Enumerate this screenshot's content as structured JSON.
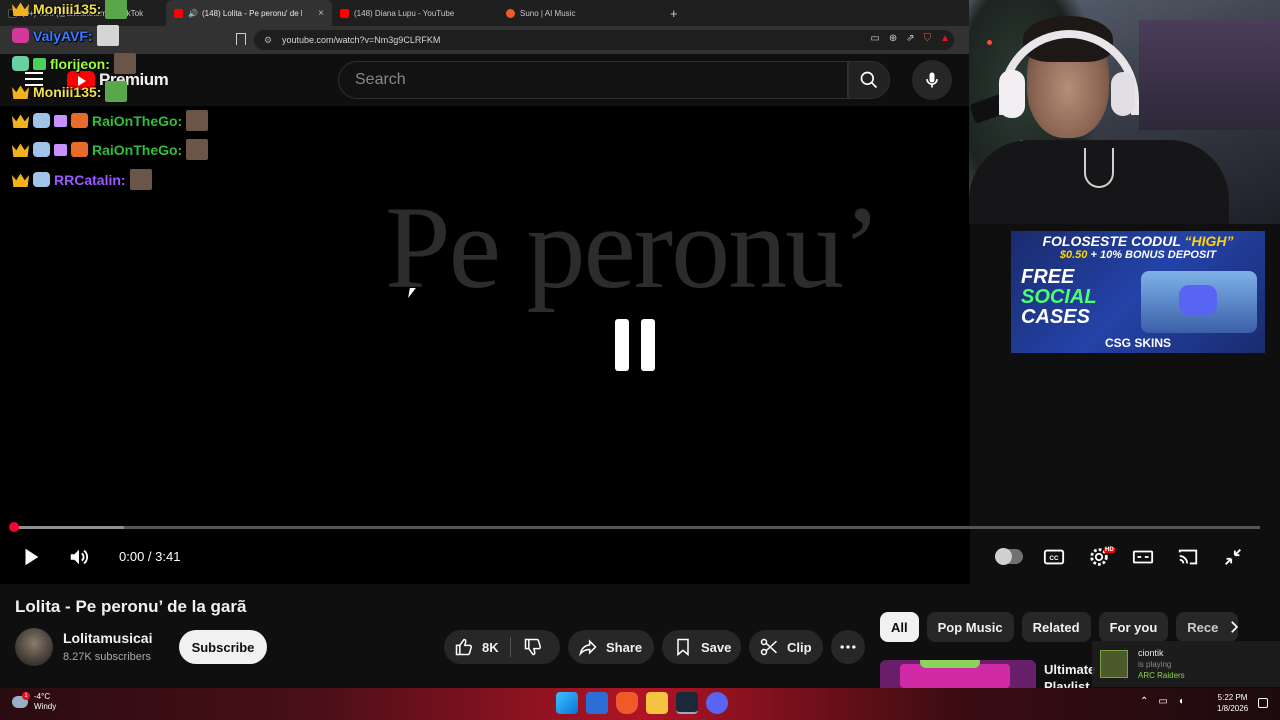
{
  "browser": {
    "tabs": [
      {
        "label": "(9+) Tom (@tototototome) / TikTok",
        "fav_color": "#111111",
        "active": false
      },
      {
        "label": "(148) Lolita - Pe peronu' de la gară",
        "fav_color": "#ff0000",
        "active": true,
        "close": "×"
      },
      {
        "label": "(148) Diana Lupu - YouTube",
        "fav_color": "#ff0000",
        "active": false
      },
      {
        "label": "Suno | AI Music",
        "fav_color": "#f05a28",
        "active": false
      }
    ],
    "new_tab": "+",
    "url": "youtube.com/watch?v=Nm3g9CLRFKM"
  },
  "youtube": {
    "logo_text": "Premium",
    "search_placeholder": "Search",
    "player": {
      "overlay_title": "Pe peronu’",
      "state": "paused-indicator",
      "time_current": "0:00",
      "time_sep": " / ",
      "time_total": "3:41",
      "progress_loaded_fraction": 0.09,
      "hd_badge": "HD"
    },
    "video": {
      "title": "Lolita - Pe peronu’ de la garã",
      "channel": "Lolitamusicai",
      "subscribers": "8.27K subscribers",
      "subscribe_label": "Subscribe",
      "likes": "8K",
      "share_label": "Share",
      "save_label": "Save",
      "clip_label": "Clip"
    },
    "chips": [
      "All",
      "Pop Music",
      "Related",
      "For you",
      "Rece"
    ],
    "recommendation": {
      "title_line1": "Ultimate",
      "title_line2": "Playlist"
    }
  },
  "chat": [
    {
      "user": "Moniii135:",
      "color": "#f4e04d",
      "badges": [
        "crown"
      ],
      "emote": "frog"
    },
    {
      "user": "ValyAVF:",
      "color": "#3a7bff",
      "badges": [
        "bot"
      ],
      "emote": "cat"
    },
    {
      "user": "florijeon:",
      "color": "#9cff3a",
      "badges": [
        "bot",
        "gift"
      ],
      "emote": "face"
    },
    {
      "user": "Moniii135:",
      "color": "#f4e04d",
      "badges": [
        "crown"
      ],
      "emote": "frog"
    },
    {
      "user": "RaiOnTheGo:",
      "color": "#2fbf3a",
      "badges": [
        "crown",
        "bot",
        "gift",
        "rl"
      ],
      "emote": "face"
    },
    {
      "user": "RaiOnTheGo:",
      "color": "#2fbf3a",
      "badges": [
        "crown",
        "bot",
        "gift",
        "rl"
      ],
      "emote": "face"
    },
    {
      "user": "RRCatalin:",
      "color": "#9b59ff",
      "badges": [
        "crown",
        "bot"
      ],
      "emote": "face"
    }
  ],
  "ad": {
    "line1_a": "FOLOSESTE CODUL ",
    "line1_b": "“HIGH”",
    "line2_a": "$0.50",
    "line2_b": " + 10% BONUS DEPOSIT",
    "free": "FREE",
    "social": "SOCIAL",
    "cases": "CASES",
    "brand": "CSG SKINS"
  },
  "toast": {
    "name": "ciontik",
    "status": "is playing",
    "game": "ARC Raiders"
  },
  "taskbar": {
    "temperature": "-4°C",
    "condition": "Windy",
    "alert_count": "1",
    "time": "5:22 PM",
    "date": "1/8/2026"
  },
  "colors": {
    "accent": "#ff0000",
    "progress": "#ff0033",
    "background": "#0f0f0f"
  }
}
